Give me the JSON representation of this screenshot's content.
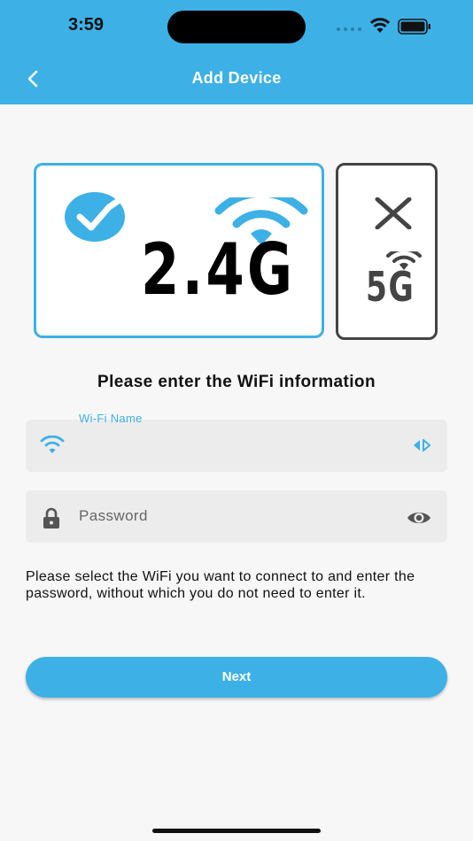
{
  "status_bar": {
    "time": "3:59"
  },
  "header": {
    "title": "Add Device"
  },
  "bands": {
    "band_24": {
      "label": "2.4G",
      "state": "supported"
    },
    "band_5": {
      "label": "5G",
      "state": "unsupported"
    }
  },
  "form": {
    "heading": "Please enter the WiFi information",
    "wifi_name": {
      "label": "Wi-Fi Name",
      "value": ""
    },
    "password": {
      "placeholder": "Password",
      "value": ""
    },
    "help_text": "Please select the WiFi you want to connect to and enter the password, without which you do not need to enter it."
  },
  "actions": {
    "next_label": "Next"
  },
  "colors": {
    "accent": "#3db0e6",
    "dark": "#444444"
  }
}
